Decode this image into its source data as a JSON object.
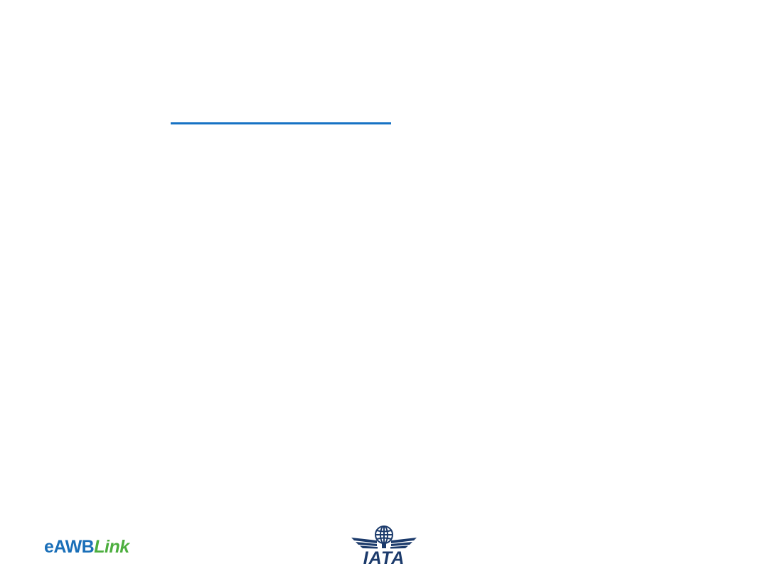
{
  "slide": {
    "title_rule_color": "#1672c4"
  },
  "footer": {
    "brand_part_a": "eAWB",
    "brand_part_b": "Link",
    "brand_color_a": "#1a6fb8",
    "brand_color_b": "#4cae3e",
    "logo_text": "IATA",
    "logo_icon": "iata-globe-wings-icon",
    "logo_color": "#1b3a6b"
  }
}
